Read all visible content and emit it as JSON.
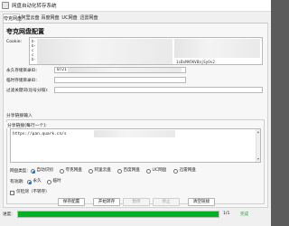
{
  "window": {
    "title": "网盘自动化转存系统"
  },
  "tabs": [
    {
      "label": "夸克网盘",
      "active": true
    },
    {
      "label": "阿里云盘",
      "active": false
    },
    {
      "label": "百度网盘",
      "active": false
    },
    {
      "label": "UC网盘",
      "active": false
    },
    {
      "label": "迅雷网盘",
      "active": false
    }
  ],
  "config": {
    "heading": "夸克网盘配置",
    "cookie_label": "Cookie:",
    "cookie_lines": [
      "b-",
      "b-",
      "c",
      "c",
      "b-"
    ],
    "cookie_tail": "1cBxMA5KV8ajSyOv2",
    "permanent_dir_label": "永久存储目录ID:",
    "permanent_dir_value": "0721",
    "temp_dir_label": "临时存储目录ID:",
    "temp_dir_value": "",
    "filter_label": "过滤关键词(逗号分隔):",
    "filter_value": ""
  },
  "share": {
    "section_title": "分享链接输入",
    "group_title": "分享链接(每行一个):",
    "text": "https://pan.quark.cn/s"
  },
  "disk_options": {
    "label": "网盘类型:",
    "options": [
      "自动识别",
      "夸克网盘",
      "阿里云盘",
      "百度网盘",
      "UC网盘",
      "迅雷网盘"
    ],
    "selected": "自动识别"
  },
  "validity": {
    "label": "有效期:",
    "options": [
      "永久",
      "临时"
    ],
    "selected": "永久"
  },
  "check_only": {
    "label": "仅检测（不转存）",
    "checked": false
  },
  "buttons": {
    "save": "保存配置",
    "start": "开始转存",
    "pause": "暂停",
    "stop": "停止",
    "clear": "清空链接"
  },
  "status": {
    "label": "进度:",
    "progress": 1.0,
    "progress_text": "1/1",
    "state": "完成",
    "bar_color": "#06b025",
    "state_color": "#2e9e3e"
  }
}
